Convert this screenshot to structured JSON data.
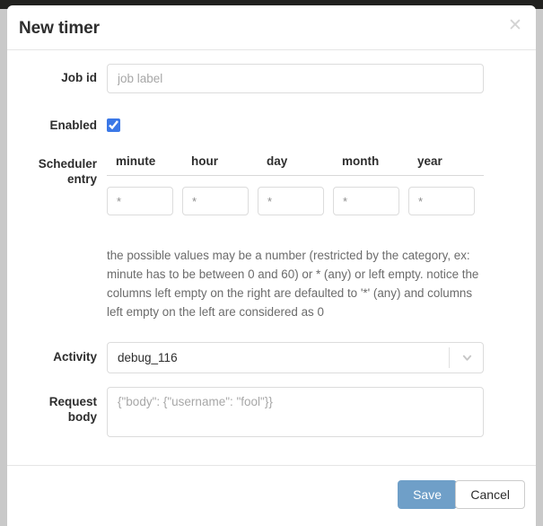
{
  "modal": {
    "title": "New timer",
    "close_icon": "close-icon"
  },
  "fields": {
    "job_id": {
      "label": "Job id",
      "placeholder": "job label",
      "value": ""
    },
    "enabled": {
      "label": "Enabled",
      "checked": true
    },
    "scheduler": {
      "label_line1": "Scheduler",
      "label_line2": "entry",
      "columns": [
        {
          "header": "minute",
          "placeholder": "*",
          "value": ""
        },
        {
          "header": "hour",
          "placeholder": "*",
          "value": ""
        },
        {
          "header": "day",
          "placeholder": "*",
          "value": ""
        },
        {
          "header": "month",
          "placeholder": "*",
          "value": ""
        },
        {
          "header": "year",
          "placeholder": "*",
          "value": ""
        }
      ],
      "help_text": "the possible values may be a number (restricted by the category, ex: minute has to be between 0 and 60) or * (any) or left empty. notice the columns left empty on the right are defaulted to '*' (any) and columns left empty on the left are considered as 0"
    },
    "activity": {
      "label": "Activity",
      "selected": "debug_116",
      "caret_icon": "chevron-down-icon"
    },
    "request_body": {
      "label_line1": "Request",
      "label_line2": "body",
      "placeholder": "{\"body\": {\"username\": \"fool\"}}",
      "value": ""
    }
  },
  "footer": {
    "save_label": "Save",
    "cancel_label": "Cancel"
  },
  "colors": {
    "save_button": "#6f9fc8",
    "checkbox_accent": "#3b78e7",
    "help_text": "#6b6b6b"
  }
}
